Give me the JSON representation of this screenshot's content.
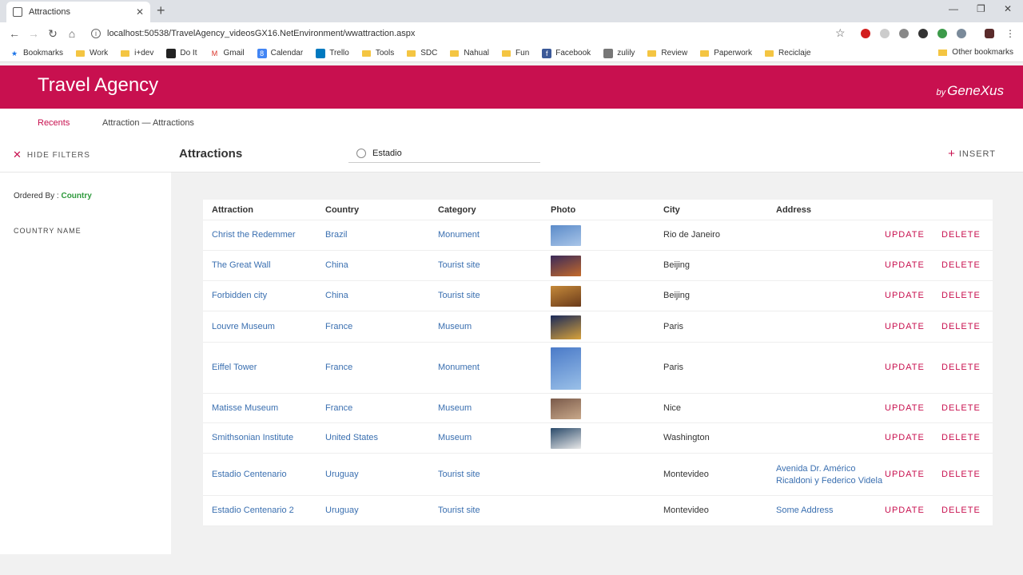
{
  "browser": {
    "tab_title": "Attractions",
    "url": "localhost:50538/TravelAgency_videosGX16.NetEnvironment/wwattraction.aspx",
    "bookmarks": [
      "Bookmarks",
      "Work",
      "i+dev",
      "Do It",
      "Gmail",
      "Calendar",
      "Trello",
      "Tools",
      "SDC",
      "Nahual",
      "Fun",
      "Facebook",
      "zulily",
      "Review",
      "Paperwork",
      "Reciclaje"
    ],
    "other_bookmarks": "Other bookmarks"
  },
  "app": {
    "title": "Travel Agency",
    "brand_by": "by",
    "brand_name": "GeneXus",
    "accent": "#c8104f"
  },
  "breadcrumb": {
    "recents": "Recents",
    "path": "Attraction — Attractions"
  },
  "toolbar": {
    "hide_filters": "HIDE FILTERS",
    "title": "Attractions",
    "search_value": "Estadio",
    "insert": "INSERT"
  },
  "filters": {
    "ordered_label": "Ordered By : ",
    "ordered_value": "Country",
    "country_name": "COUNTRY NAME"
  },
  "grid": {
    "columns": [
      "Attraction",
      "Country",
      "Category",
      "Photo",
      "City",
      "Address"
    ],
    "update_label": "UPDATE",
    "delete_label": "DELETE",
    "rows": [
      {
        "attraction": "Christ the Redemmer",
        "country": "Brazil",
        "category": "Monument",
        "has_photo": true,
        "city": "Rio de Janeiro",
        "address": ""
      },
      {
        "attraction": "The Great Wall",
        "country": "China",
        "category": "Tourist site",
        "has_photo": true,
        "city": "Beijing",
        "address": ""
      },
      {
        "attraction": "Forbidden city",
        "country": "China",
        "category": "Tourist site",
        "has_photo": true,
        "city": "Beijing",
        "address": ""
      },
      {
        "attraction": "Louvre Museum",
        "country": "France",
        "category": "Museum",
        "has_photo": true,
        "city": "Paris",
        "address": ""
      },
      {
        "attraction": "Eiffel Tower",
        "country": "France",
        "category": "Monument",
        "has_photo": true,
        "city": "Paris",
        "address": ""
      },
      {
        "attraction": "Matisse Museum",
        "country": "France",
        "category": "Museum",
        "has_photo": true,
        "city": "Nice",
        "address": ""
      },
      {
        "attraction": "Smithsonian Institute",
        "country": "United States",
        "category": "Museum",
        "has_photo": true,
        "city": "Washington",
        "address": ""
      },
      {
        "attraction": "Estadio Centenario",
        "country": "Uruguay",
        "category": "Tourist site",
        "has_photo": false,
        "city": "Montevideo",
        "address": "Avenida Dr. Américo Ricaldoni y Federico Videla"
      },
      {
        "attraction": "Estadio Centenario 2",
        "country": "Uruguay",
        "category": "Tourist site",
        "has_photo": false,
        "city": "Montevideo",
        "address": "Some Address"
      }
    ]
  }
}
